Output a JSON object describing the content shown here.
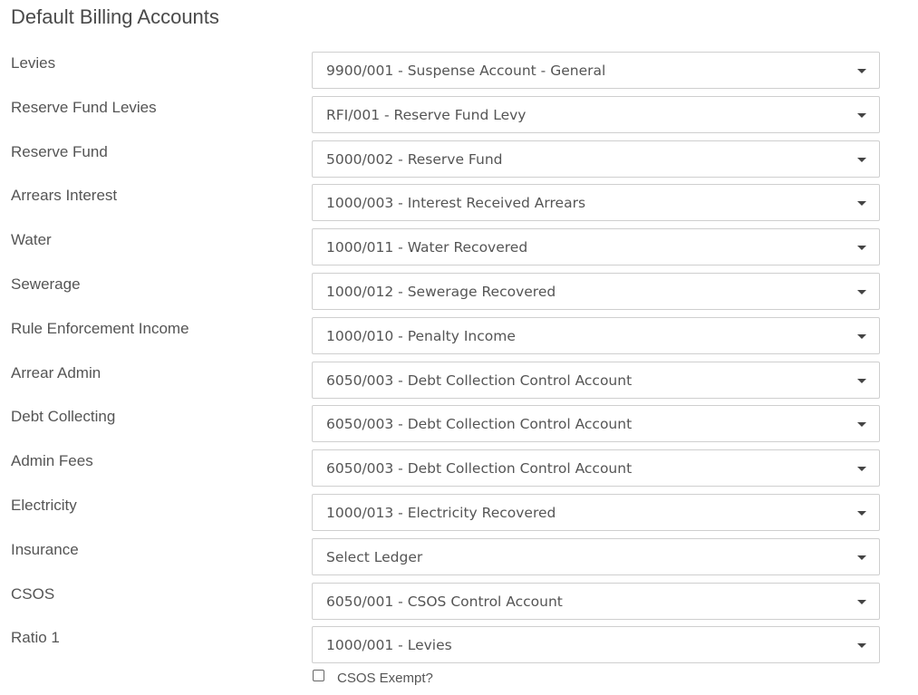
{
  "page": {
    "title": "Default Billing Accounts"
  },
  "fields": [
    {
      "label": "Levies",
      "value": "9900/001 - Suspense Account - General"
    },
    {
      "label": "Reserve Fund Levies",
      "value": "RFI/001 - Reserve Fund Levy"
    },
    {
      "label": "Reserve Fund",
      "value": "5000/002 - Reserve Fund"
    },
    {
      "label": "Arrears Interest",
      "value": "1000/003 - Interest Received Arrears"
    },
    {
      "label": "Water",
      "value": "1000/011 - Water Recovered"
    },
    {
      "label": "Sewerage",
      "value": "1000/012 - Sewerage Recovered"
    },
    {
      "label": "Rule Enforcement Income",
      "value": "1000/010 - Penalty Income"
    },
    {
      "label": "Arrear Admin",
      "value": "6050/003 - Debt Collection Control Account"
    },
    {
      "label": "Debt Collecting",
      "value": "6050/003 - Debt Collection Control Account"
    },
    {
      "label": "Admin Fees",
      "value": "6050/003 - Debt Collection Control Account"
    },
    {
      "label": "Electricity",
      "value": "1000/013 - Electricity Recovered"
    },
    {
      "label": "Insurance",
      "value": "Select Ledger"
    },
    {
      "label": "CSOS",
      "value": "6050/001 - CSOS Control Account"
    },
    {
      "label": "Ratio 1",
      "value": "1000/001 - Levies"
    }
  ],
  "csos_exempt": {
    "label": "CSOS Exempt?",
    "checked": false
  },
  "icons": {
    "dropdown": "chevron-down-icon"
  }
}
